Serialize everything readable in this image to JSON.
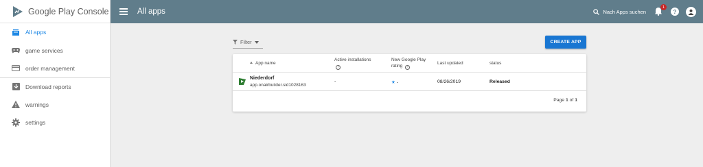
{
  "brand": {
    "name": "Google Play Console"
  },
  "sidebar": {
    "items": [
      {
        "label": "All apps",
        "icon": "apps-icon",
        "active": true
      },
      {
        "label": "game services",
        "icon": "gamepad-icon"
      },
      {
        "label": "order management",
        "icon": "credit-card-icon"
      },
      {
        "label": "Download reports",
        "icon": "download-icon"
      },
      {
        "label": "warnings",
        "icon": "warning-icon"
      },
      {
        "label": "settings",
        "icon": "gear-icon"
      }
    ]
  },
  "header": {
    "title": "All apps",
    "search_label": "Nach Apps suchen",
    "notification_count": "1",
    "help_symbol": "?"
  },
  "toolbar": {
    "filter_label": "Filter",
    "create_label": "CREATE APP"
  },
  "table": {
    "columns": {
      "app_name": "App name",
      "active_installations": "Active installations",
      "rating": "New Google Play rating",
      "last_updated": "Last updated",
      "status": "status"
    },
    "rows": [
      {
        "name": "Niederdorf",
        "package": "app.onairbuilder.sid1028163",
        "installations": "-",
        "rating": "-",
        "last_updated": "08/26/2019",
        "status": "Released"
      }
    ],
    "pager": {
      "prefix": "Page",
      "current": "1",
      "separator": "of",
      "total": "1"
    }
  },
  "colors": {
    "topbar": "#607d8b",
    "accent": "#1976d2",
    "active_nav": "#1e88e5"
  }
}
